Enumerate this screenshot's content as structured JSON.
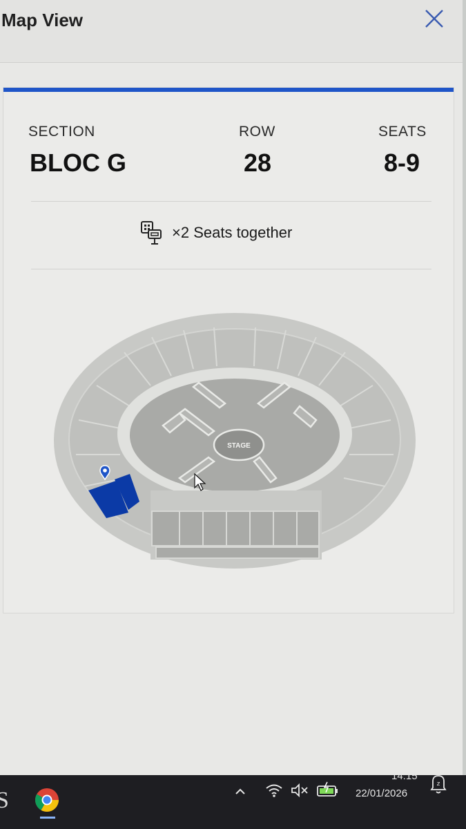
{
  "window": {
    "title": "Map View"
  },
  "ticket": {
    "section_label": "SECTION",
    "section_value": "BLOC G",
    "row_label": "ROW",
    "row_value": "28",
    "seats_label": "SEATS",
    "seats_value": "8-9",
    "together_text": "×2 Seats together"
  },
  "venue_map": {
    "stage_label": "STAGE",
    "selected_section": "BLOC G",
    "highlight_color": "#0b3aa6"
  },
  "colors": {
    "accent": "#1f55c8"
  },
  "taskbar": {
    "time": "14:15",
    "date": "22/01/2026",
    "icons": [
      "chrome-icon",
      "chevron-up-icon",
      "wifi-icon",
      "speaker-muted-icon",
      "battery-icon",
      "notification-icon"
    ]
  }
}
